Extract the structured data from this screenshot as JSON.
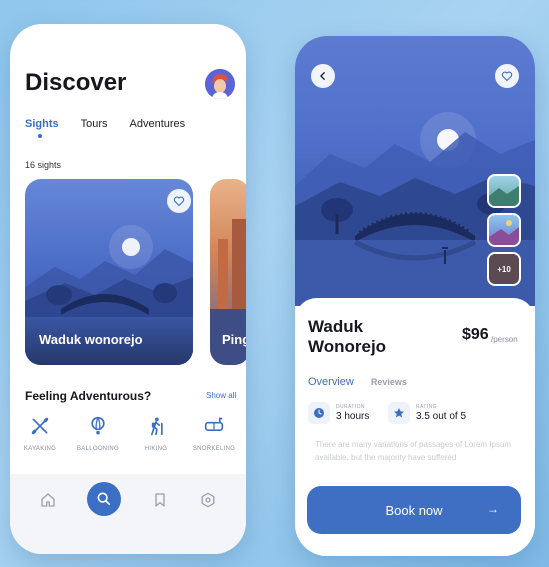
{
  "discover": {
    "title": "Discover",
    "tabs": [
      {
        "label": "Sights",
        "active": true
      },
      {
        "label": "Tours",
        "active": false
      },
      {
        "label": "Adventures",
        "active": false
      }
    ],
    "sights_count": "16 sights",
    "cards": [
      {
        "title": "Waduk wonorejo"
      },
      {
        "title": "Ping"
      }
    ],
    "adventure_section": {
      "title": "Feeling Adventurous?",
      "show_all": "Show all"
    },
    "categories": [
      {
        "label": "KAYAKING",
        "icon": "kayak-icon"
      },
      {
        "label": "BALLOONING",
        "icon": "hot-air-balloon-icon"
      },
      {
        "label": "HIKING",
        "icon": "hiker-icon"
      },
      {
        "label": "SNORKELING",
        "icon": "snorkel-mask-icon"
      }
    ],
    "bottom_nav": [
      {
        "icon": "home-icon"
      },
      {
        "icon": "search-icon",
        "active": true
      },
      {
        "icon": "bookmark-icon"
      },
      {
        "icon": "settings-icon"
      }
    ]
  },
  "detail": {
    "name_line1": "Waduk",
    "name_line2": "Wonorejo",
    "price": "$96",
    "price_unit": "/person",
    "tabs": [
      {
        "label": "Overview",
        "active": true
      },
      {
        "label": "Reviews",
        "active": false
      }
    ],
    "duration": {
      "label": "DURATION",
      "value": "3 hours"
    },
    "rating": {
      "label": "RATING",
      "value": "3.5 out of 5"
    },
    "description": "There are many variations of passages of Lorem Ipsum available, but the majority have suffered",
    "gallery_more": "+10",
    "book_label": "Book now",
    "book_arrow": "→"
  },
  "colors": {
    "accent": "#3a6fc4",
    "book_button": "#3f6fc3",
    "background": "#a9d3f1"
  }
}
